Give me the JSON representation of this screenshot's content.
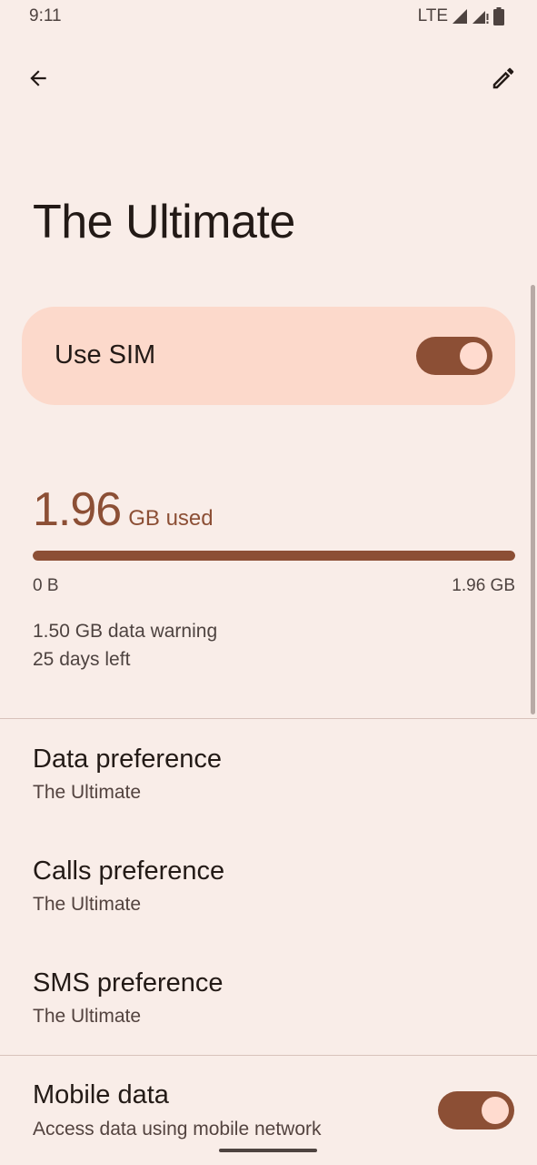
{
  "status_bar": {
    "time": "9:11",
    "network": "LTE",
    "icons": [
      "signal-icon",
      "signal-roaming-icon",
      "battery-icon"
    ]
  },
  "app_bar": {
    "back_icon": "arrow-back-icon",
    "edit_icon": "pencil-edit-icon"
  },
  "page": {
    "title": "The Ultimate"
  },
  "use_sim": {
    "label": "Use SIM",
    "enabled": true
  },
  "data_usage": {
    "amount": "1.96",
    "unit": "GB used",
    "fill_fraction": 1.0,
    "range_min": "0 B",
    "range_max": "1.96 GB",
    "warning": "1.50 GB data warning",
    "days_left": "25 days left"
  },
  "preferences": [
    {
      "title": "Data preference",
      "subtitle": "The Ultimate"
    },
    {
      "title": "Calls preference",
      "subtitle": "The Ultimate"
    },
    {
      "title": "SMS preference",
      "subtitle": "The Ultimate"
    }
  ],
  "mobile_data": {
    "title": "Mobile data",
    "subtitle": "Access data using mobile network",
    "enabled": true
  },
  "colors": {
    "background": "#f9ede8",
    "accent": "#8c4f35",
    "card": "#fcd9cb",
    "knob": "#ffdbcf"
  }
}
